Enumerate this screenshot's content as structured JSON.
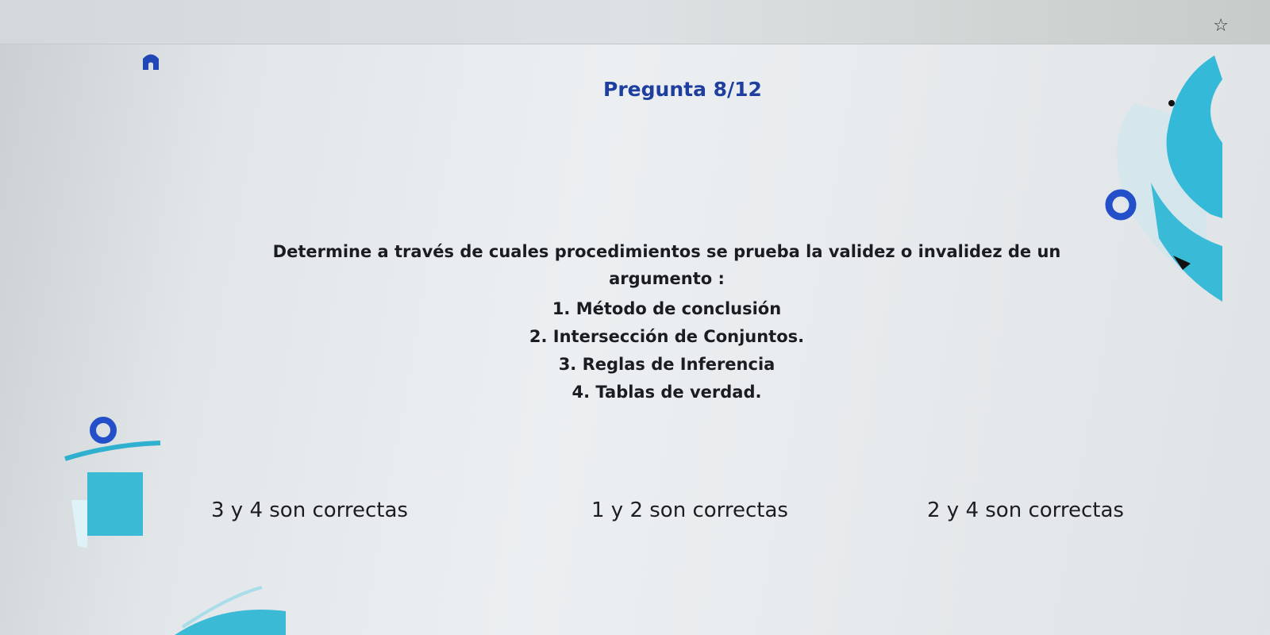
{
  "quiz": {
    "progress_label": "Pregunta 8/12",
    "question": {
      "prompt": "Determine a través de cuales procedimientos se prueba la validez o invalidez de un argumento :",
      "items": [
        "1. Método de conclusión",
        "2. Intersección de Conjuntos.",
        "3. Reglas de Inferencia",
        "4. Tablas de verdad."
      ]
    },
    "answers": [
      "3 y 4 son correctas",
      "1 y 2 son correctas",
      "2 y 4 son correctas"
    ]
  },
  "browser": {
    "bookmark_icon": "star-icon"
  },
  "colors": {
    "title": "#1e3f9e",
    "accent_teal": "#2fb8d6",
    "accent_blue": "#2350c8"
  }
}
